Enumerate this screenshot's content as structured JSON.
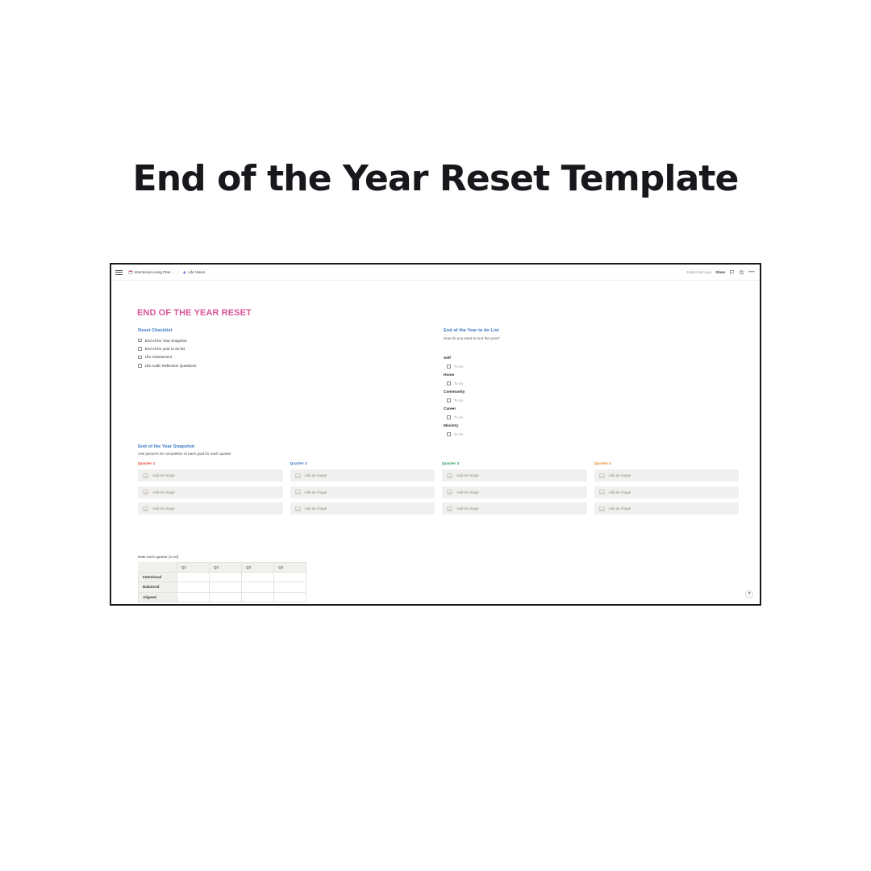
{
  "page_title": "End of the Year Reset Template",
  "browser": {
    "topbar": {
      "menu_icon": "hamburger-icon",
      "breadcrumb": [
        {
          "icon": "page-icon",
          "label": "Intentional Living Plan ...",
          "tail": ""
        },
        {
          "icon": "vision-icon",
          "label": "Life Vision",
          "tail": "..."
        }
      ],
      "separator": "/",
      "edited_status": "Edited 56m ago",
      "share_label": "Share",
      "comment_icon": "comment-icon",
      "favorite_icon": "star-icon",
      "more_icon": "ellipsis-icon"
    },
    "help_button": "?"
  },
  "document": {
    "heading": "END OF THE YEAR RESET",
    "reset_checklist": {
      "title": "Reset Checklist",
      "items": [
        "End of the Year Snapshot",
        "End of the year to do list",
        "Life Assessment",
        "Life Audit: Reflection Questions"
      ]
    },
    "todo_list": {
      "title": "End of the Year to do List",
      "subtitle": "How do you want to end the year?",
      "groups": [
        {
          "name": "Self",
          "item": "To-do"
        },
        {
          "name": "Home",
          "item": "To-do"
        },
        {
          "name": "Community",
          "item": "To-do"
        },
        {
          "name": "Career",
          "item": "To-do"
        },
        {
          "name": "Ministry",
          "item": "To-do"
        }
      ]
    },
    "snapshot": {
      "title": "End of the Year Snapshot",
      "subtitle": "Use pictures for completion of each goal for each quarter",
      "placeholder_label": "Add an image",
      "quarters": [
        {
          "label": "Quarter 1",
          "color": "#e24a36",
          "slots": 3
        },
        {
          "label": "Quarter 2",
          "color": "#3a77c4",
          "slots": 3
        },
        {
          "label": "Quarter 3",
          "color": "#2f9a5e",
          "slots": 3
        },
        {
          "label": "Quarter 4",
          "color": "#e8872a",
          "slots": 3
        }
      ]
    },
    "rating": {
      "caption": "Rate each quarter (1-10)",
      "columns": [
        "Q1",
        "Q2",
        "Q3",
        "Q4"
      ],
      "rows": [
        "Intentional",
        "Balanced",
        "Aligned"
      ]
    }
  },
  "colors": {
    "heading_pink": "#d8559a",
    "section_blue": "#3a77c4",
    "title_black": "#16181c"
  }
}
